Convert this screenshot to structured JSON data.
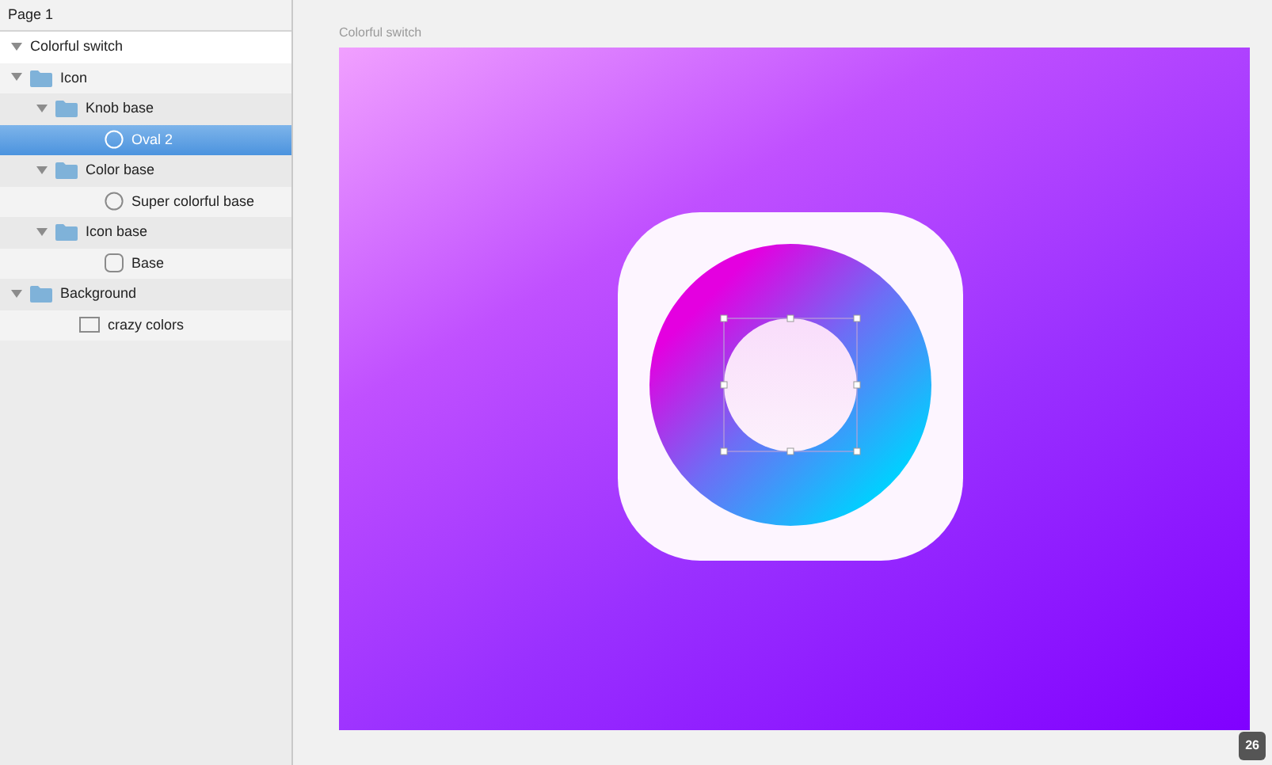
{
  "page": {
    "title": "Page 1"
  },
  "layers": [
    {
      "name": "Colorful switch",
      "kind": "artboard",
      "expanded": true,
      "selected": false,
      "children": [
        {
          "name": "Icon",
          "kind": "group",
          "expanded": true,
          "selected": false,
          "children": [
            {
              "name": "Knob base",
              "kind": "group",
              "expanded": true,
              "selected": false,
              "children": [
                {
                  "name": "Oval 2",
                  "kind": "oval",
                  "selected": true
                }
              ]
            },
            {
              "name": "Color base",
              "kind": "group",
              "expanded": true,
              "selected": false,
              "children": [
                {
                  "name": "Super colorful base",
                  "kind": "oval",
                  "selected": false
                }
              ]
            },
            {
              "name": "Icon base",
              "kind": "group",
              "expanded": true,
              "selected": false,
              "children": [
                {
                  "name": "Base",
                  "kind": "rounded",
                  "selected": false
                }
              ]
            }
          ]
        },
        {
          "name": "Background",
          "kind": "group",
          "expanded": true,
          "selected": false,
          "children": [
            {
              "name": "crazy colors",
              "kind": "rect",
              "selected": false
            }
          ]
        }
      ]
    }
  ],
  "canvas": {
    "artboard_title": "Colorful switch",
    "knob_selected": true
  },
  "zoom_badge": "26"
}
